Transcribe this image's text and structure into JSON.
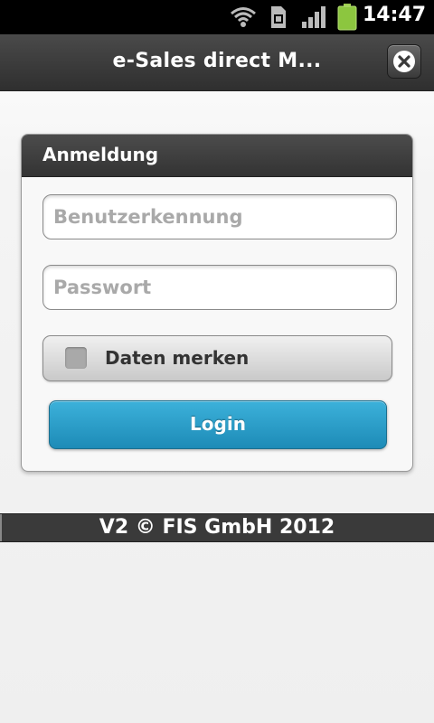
{
  "status_bar": {
    "time": "14:47",
    "icons": [
      "wifi-icon",
      "sim-card-icon",
      "signal-icon",
      "battery-icon"
    ]
  },
  "header": {
    "title": "e-Sales direct M...",
    "close_icon": "close-icon"
  },
  "login_panel": {
    "title": "Anmeldung",
    "username": {
      "placeholder": "Benutzerkennung",
      "value": ""
    },
    "password": {
      "placeholder": "Passwort",
      "value": ""
    },
    "remember": {
      "label": "Daten merken",
      "checked": false
    },
    "login_label": "Login"
  },
  "footer": {
    "text": "V2 © FIS GmbH 2012"
  },
  "colors": {
    "accent": "#2a9fcc",
    "header_bg": "#3a3a3a",
    "battery": "#8cc63f"
  }
}
